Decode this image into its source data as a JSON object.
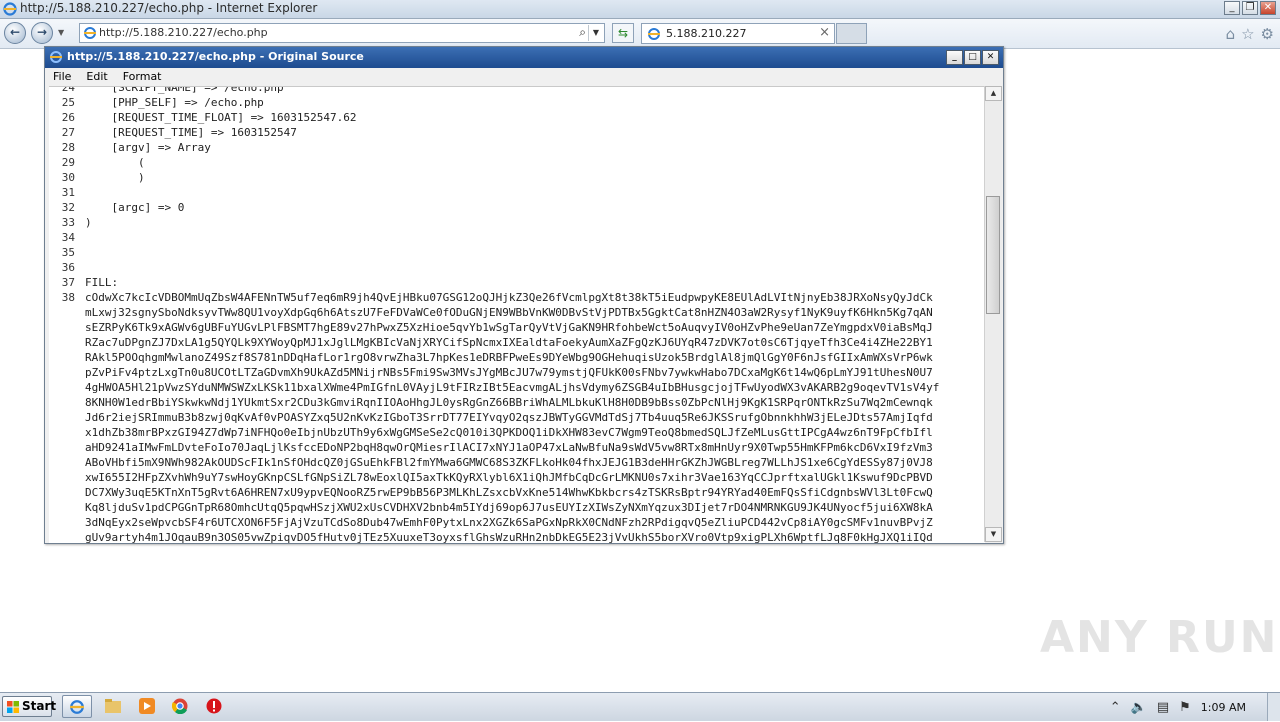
{
  "browser": {
    "window_title": "http://5.188.210.227/echo.php - Internet Explorer",
    "address_url": "http://5.188.210.227/echo.php",
    "tab_title": "5.188.210.227"
  },
  "source_window": {
    "title": "http://5.188.210.227/echo.php - Original Source",
    "menu": [
      "File",
      "Edit",
      "Format"
    ],
    "lines": [
      {
        "n": "24",
        "text": "    [SCRIPT_NAME] => /echo.php"
      },
      {
        "n": "25",
        "text": "    [PHP_SELF] => /echo.php"
      },
      {
        "n": "26",
        "text": "    [REQUEST_TIME_FLOAT] => 1603152547.62"
      },
      {
        "n": "27",
        "text": "    [REQUEST_TIME] => 1603152547"
      },
      {
        "n": "28",
        "text": "    [argv] => Array"
      },
      {
        "n": "29",
        "text": "        ("
      },
      {
        "n": "30",
        "text": "        )"
      },
      {
        "n": "31",
        "text": ""
      },
      {
        "n": "32",
        "text": "    [argc] => 0"
      },
      {
        "n": "33",
        "text": ")"
      },
      {
        "n": "34",
        "text": ""
      },
      {
        "n": "35",
        "text": ""
      },
      {
        "n": "36",
        "text": ""
      },
      {
        "n": "37",
        "text": "FILL:"
      },
      {
        "n": "38",
        "text": "cOdwXc7kcIcVDBOMmUqZbsW4AFENnTW5uf7eq6mR9jh4QvEjHBku07GSG12oQJHjkZ3Qe26fVcmlpgXt8t38kT5iEudpwpyKE8EUlAdLVItNjnyEb38JRXoNsyQyJdCk"
      },
      {
        "n": "",
        "text": "mLxwj32sgnySboNdksyvTWw8QU1voyXdpGq6h6AtszU7FeFDVaWCe0fODuGNjEN9WBbVnKW0DBvStVjPDTBx5GgktCat8nHZN4O3aW2Rysyf1NyK9uyfK6Hkn5Kg7qAN"
      },
      {
        "n": "",
        "text": "sEZRPyK6Tk9xAGWv6gUBFuYUGvLPlFBSMT7hgE89v27hPwxZ5XzHioe5qvYb1wSgTarQyVtVjGaKN9HRfohbeWct5oAuqvyIV0oHZvPhe9eUan7ZeYmgpdxV0iaBsMqJ"
      },
      {
        "n": "",
        "text": "RZac7uDPgnZJ7DxLA1g5QYQLk9XYWoyQpMJ1xJglLMgKBIcVaNjXRYCifSpNcmxIXEaldtaFoekyAumXaZFgQzKJ6UYqR47zDVK7ot0sC6TjqyeTfh3Ce4i4ZHe22BY1"
      },
      {
        "n": "",
        "text": "RAkl5POOqhgmMwlanoZ49Szf8S781nDDqHafLor1rgO8vrwZha3L7hpKes1eDRBFPweEs9DYeWbg9OGHehuqisUzok5BrdglAl8jmQlGgY0F6nJsfGIIxAmWXsVrP6wk"
      },
      {
        "n": "",
        "text": "pZvPiFv4ptzLxgTn0u8UCOtLTZaGDvmXh9UkAZd5MNijrNBs5Fmi9Sw3MVsJYgMBcJU7w79ymstjQFUkK00sFNbv7ywkwHabo7DCxaMgK6t14wQ6pLmYJ91tUhesN0U7"
      },
      {
        "n": "",
        "text": "4gHWOA5Hl21pVwzSYduNMWSWZxLKSk11bxalXWme4PmIGfnL0VAyjL9tFIRzIBt5EacvmgALjhsVdymy6ZSGB4uIbBHusgcjojTFwUyodWX3vAKARB2g9oqevTV1sV4yf"
      },
      {
        "n": "",
        "text": "8KNH0W1edrBbiYSkwkwNdj1YUkmtSxr2CDu3kGmviRqnIIOAoHhgJL0ysRgGnZ66BBriWhALMLbkuKlH8H0DB9bBss0ZbPcNlHj9KgK1SRPqrONTkRzSu7Wq2mCewnqk"
      },
      {
        "n": "",
        "text": "Jd6r2iejSRImmuB3b8zwj0qKvAf0vPOASYZxq5U2nKvKzIGboT3SrrDT77EIYvqyO2qszJBWTyGGVMdTdSj7Tb4uuq5Re6JKSSrufgObnnkhhW3jELeJDts57AmjIqfd"
      },
      {
        "n": "",
        "text": "x1dhZb38mrBPxzGI94Z7dWp7iNFHQo0eIbjnUbzUTh9y6xWgGMSeSe2cQ010i3QPKDOQ1iDkXHW83evC7Wgm9TeoQ8bmedSQLJfZeMLusGttIPCgA4wz6nT9FpCfbIfl"
      },
      {
        "n": "",
        "text": "aHD9241aIMwFmLDvteFoIo70JaqLjlKsfccEDoNP2bqH8qwOrQMiesrIlACI7xNYJ1aOP47xLaNwBfuNa9sWdV5vw8RTx8mHnUyr9X0Twp55HmKFPm6kcD6VxI9fzVm3"
      },
      {
        "n": "",
        "text": "ABoVHbfi5mX9NWh982AkOUDScFIk1nSfOHdcQZ0jGSuEhkFBl2fmYMwa6GMWC68S3ZKFLkoHk04fhxJEJG1B3deHHrGKZhJWGBLreg7WLLhJS1xe6CgYdESSy87j0VJ8"
      },
      {
        "n": "",
        "text": "xwI655I2HFpZXvhWh9uY7swHoyGKnpCSLfGNpSiZL78wEoxlQI5axTkKQyRXlybl6X1iQhJMfbCqDcGrLMKNU0s7xihr3Vae163YqCCJprftxalUGkl1Kswuf9DcPBVD"
      },
      {
        "n": "",
        "text": "DC7XWy3uqE5KTnXnT5gRvt6A6HREN7xU9ypvEQNooRZ5rwEP9bB56P3MLKhLZsxcbVxKne514WhwKbkbcrs4zTSKRsBptr94YRYad40EmFQsSfiCdgnbsWVl3Lt0FcwQ"
      },
      {
        "n": "",
        "text": "Kq8ljduSv1pdCPGGnTpR68OmhcUtqQ5pqwHSzjXWU2xUsCVDHXV2bnb4m5IYdj69op6J7usEUYIzXIWsZyNXmYqzux3DIjet7rDO4NMRNKGU9JK4UNyocf5jui6XW8kA"
      },
      {
        "n": "",
        "text": "3dNqEyx2seWpvcbSF4r6UTCXON6F5FjAjVzuTCdSo8Dub47wEmhF0PytxLnx2XGZk6SaPGxNpRkX0CNdNFzh2RPdigqvQ5eZliuPCD442vCp8iAY0gcSMFv1nuvBPvjZ"
      },
      {
        "n": "",
        "text": "gUv9artyh4m1JOqauB9n3OS05vwZpiqvDO5fHutv0jTEz5XuuxeT3oyxsflGhsWzuRHn2nbDkEG5E23jVvUkhS5borXVro0Vtp9xigPLXh6WptfLJq8F0kHgJXQ1iIQd"
      }
    ]
  },
  "watermark": "ANY RUN",
  "taskbar": {
    "start_label": "Start",
    "clock": "1:09 AM"
  }
}
